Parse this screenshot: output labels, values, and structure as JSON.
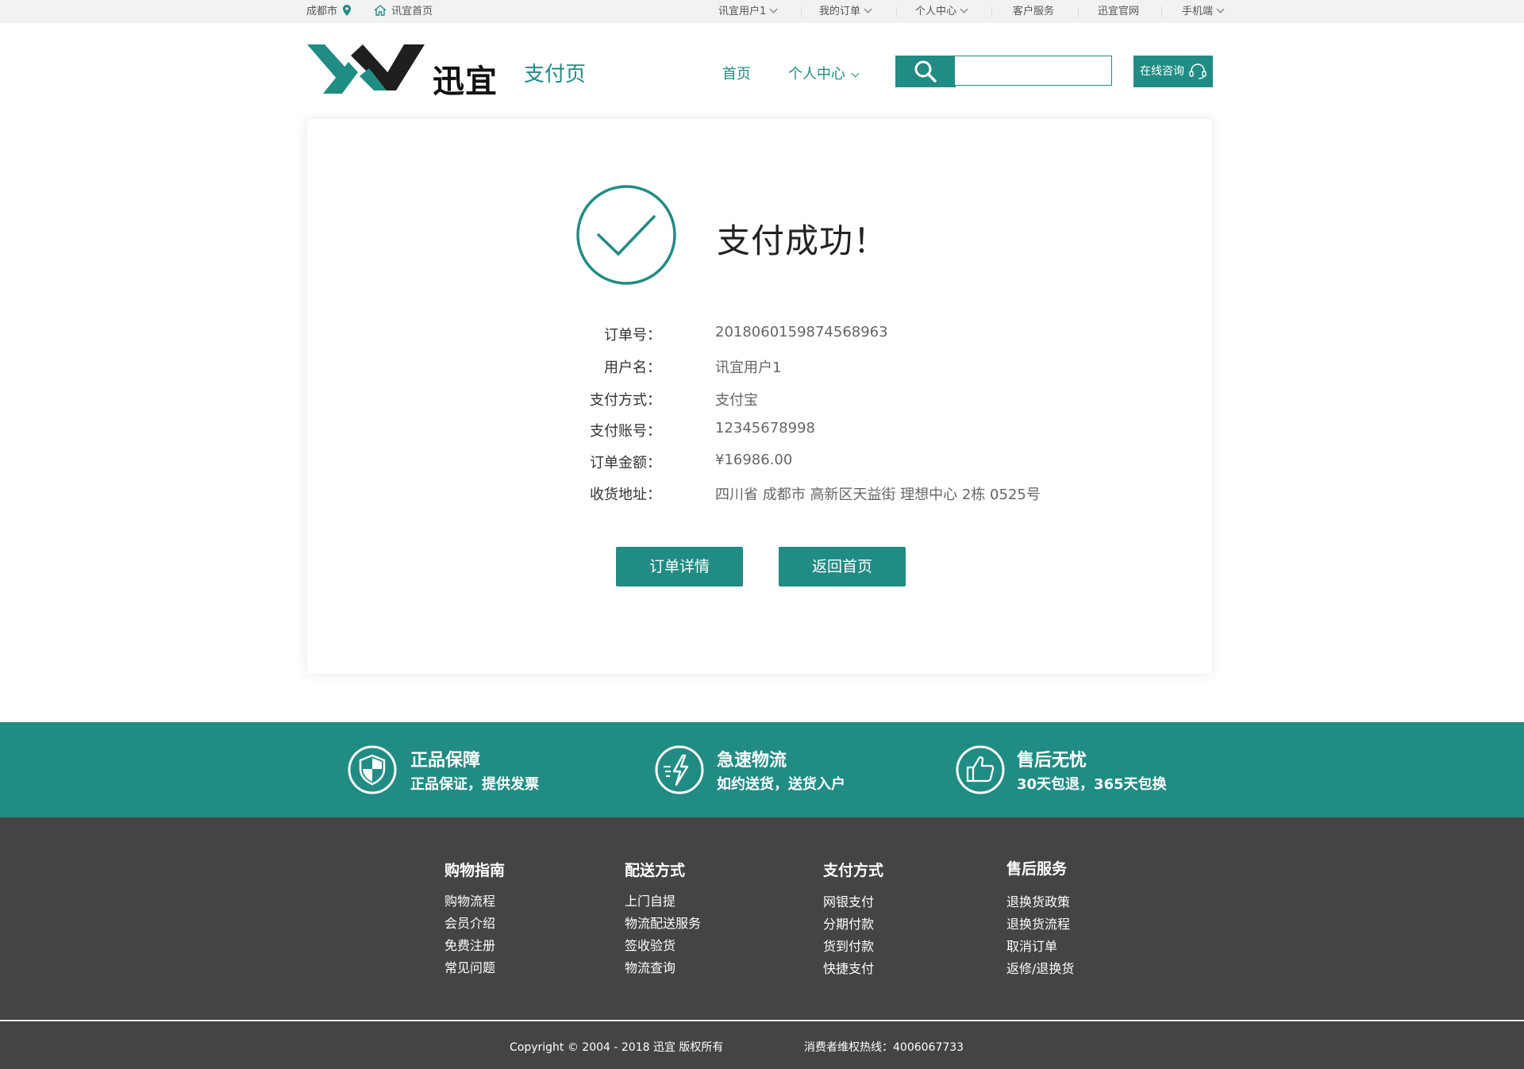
{
  "topbar": {
    "city": "成都市",
    "home_link": "讯宜首页",
    "menu": [
      {
        "label": "讯宜用户1",
        "dropdown": true
      },
      {
        "label": "我的订单",
        "dropdown": true
      },
      {
        "label": "个人中心",
        "dropdown": true
      },
      {
        "label": "客户服务",
        "dropdown": false
      },
      {
        "label": "迅宜官网",
        "dropdown": false
      },
      {
        "label": "手机端",
        "dropdown": true
      }
    ]
  },
  "header": {
    "logo_text": "迅宜",
    "page_title": "支付页",
    "nav": [
      {
        "label": "首页"
      },
      {
        "label": "个人中心"
      }
    ],
    "search_placeholder": "",
    "consult_label": "在线咨询"
  },
  "result": {
    "title": "支付成功！",
    "fields": [
      {
        "label": "订单号：",
        "value": "2018060159874568963"
      },
      {
        "label": "用户名：",
        "value": "讯宜用户1"
      },
      {
        "label": "支付方式：",
        "value": "支付宝"
      },
      {
        "label": "支付账号：",
        "value": "12345678998"
      },
      {
        "label": "订单金额：",
        "value": "¥16986.00"
      },
      {
        "label": "收货地址：",
        "value": "四川省 成都市 高新区天益街 理想中心 2栋 0525号"
      }
    ],
    "buttons": {
      "detail": "订单详情",
      "home": "返回首页"
    }
  },
  "features": [
    {
      "title": "正品保障",
      "sub": "正品保证，提供发票",
      "icon": "shield-icon"
    },
    {
      "title": "急速物流",
      "sub": "如约送货，送货入户",
      "icon": "lightning-icon"
    },
    {
      "title": "售后无忧",
      "sub": "30天包退，365天包换",
      "icon": "thumbs-up-icon"
    }
  ],
  "footer": {
    "columns": [
      {
        "title": "购物指南",
        "links": [
          "购物流程",
          "会员介绍",
          "免费注册",
          "常见问题"
        ]
      },
      {
        "title": "配送方式",
        "links": [
          "上门自提",
          "物流配送服务",
          "签收验货",
          "物流查询"
        ]
      },
      {
        "title": "支付方式",
        "links": [
          "网银支付",
          "分期付款",
          "货到付款",
          "快捷支付"
        ]
      },
      {
        "title": "售后服务",
        "links": [
          "退换货政策",
          "退换货流程",
          "取消订单",
          "返修/退换货"
        ]
      }
    ],
    "copyright": "Copyright © 2004 - 2018  迅宜 版权所有",
    "hotline": "消费者维权热线：4006067733"
  },
  "colors": {
    "accent": "#218c84",
    "footer_bg": "#444444",
    "topbar_bg": "#f2f2f2"
  }
}
